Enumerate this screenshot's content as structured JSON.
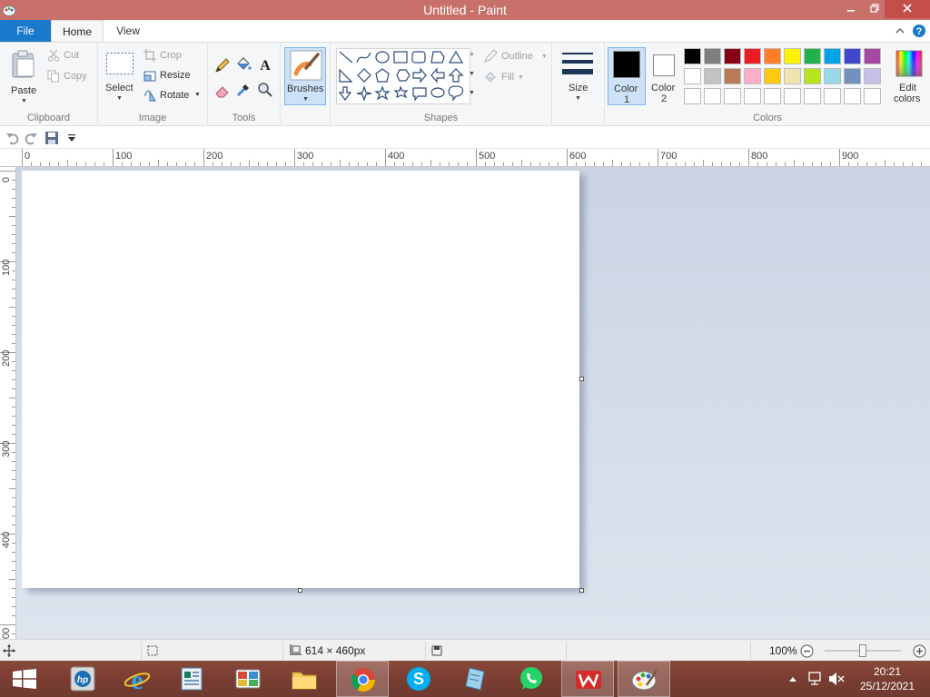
{
  "window": {
    "title": "Untitled - Paint"
  },
  "tabs": {
    "file": "File",
    "home": "Home",
    "view": "View"
  },
  "clipboard": {
    "paste": "Paste",
    "cut": "Cut",
    "copy": "Copy",
    "label": "Clipboard"
  },
  "image": {
    "select": "Select",
    "crop": "Crop",
    "resize": "Resize",
    "rotate": "Rotate",
    "label": "Image"
  },
  "tools": {
    "label": "Tools"
  },
  "brushes": {
    "label": "Brushes"
  },
  "shapes": {
    "outline": "Outline",
    "fill": "Fill",
    "label": "Shapes"
  },
  "size": {
    "label": "Size"
  },
  "colors": {
    "color1_line1": "Color",
    "color1_line2": "1",
    "color2_line1": "Color",
    "color2_line2": "2",
    "edit_line1": "Edit",
    "edit_line2": "colors",
    "label": "Colors",
    "color1": "#000000",
    "color2": "#ffffff",
    "palette_row1": [
      "#000000",
      "#7f7f7f",
      "#880015",
      "#ed1c24",
      "#ff7f27",
      "#fff200",
      "#22b14c",
      "#00a2e8",
      "#3f48cc",
      "#a349a4"
    ],
    "palette_row2": [
      "#ffffff",
      "#c3c3c3",
      "#b97a57",
      "#ffaec9",
      "#ffc90e",
      "#efe4b0",
      "#b5e61d",
      "#99d9ea",
      "#7092be",
      "#c8bfe7"
    ],
    "palette_row3": [
      "#ffffff",
      "#ffffff",
      "#ffffff",
      "#ffffff",
      "#ffffff",
      "#ffffff",
      "#ffffff",
      "#ffffff",
      "#ffffff",
      "#ffffff"
    ]
  },
  "ruler": {
    "h_labels": [
      "0",
      "100",
      "200",
      "300",
      "400",
      "500",
      "600",
      "700",
      "800",
      "900"
    ],
    "v_labels": [
      "0",
      "100",
      "200",
      "300",
      "400",
      "00"
    ]
  },
  "status": {
    "canvas_size": "614 × 460px",
    "zoom": "100%"
  },
  "taskbar": {
    "time": "20:21",
    "date": "25/12/2021"
  }
}
